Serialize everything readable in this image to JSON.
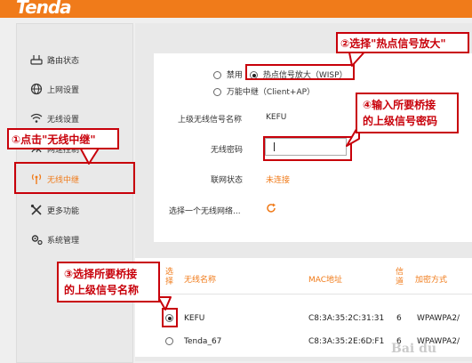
{
  "header": {
    "logo": "Tenda"
  },
  "sidebar": {
    "items": [
      {
        "label": "路由状态",
        "icon": "router-icon"
      },
      {
        "label": "上网设置",
        "icon": "globe-icon"
      },
      {
        "label": "无线设置",
        "icon": "wifi-icon"
      },
      {
        "label": "网速控制",
        "icon": "speed-icon"
      },
      {
        "label": "无线中继",
        "icon": "repeater-icon"
      },
      {
        "label": "更多功能",
        "icon": "tools-icon"
      },
      {
        "label": "系统管理",
        "icon": "gear-icon"
      }
    ]
  },
  "mode": {
    "options": [
      {
        "label": "禁用",
        "selected": false
      },
      {
        "label": "热点信号放大（WISP）",
        "selected": true
      },
      {
        "label": "万能中继（Client+AP）",
        "selected": false
      }
    ]
  },
  "form": {
    "ssid_label": "上级无线信号名称",
    "ssid_value": "KEFU",
    "password_label": "无线密码",
    "password_value": "",
    "status_label": "联网状态",
    "status_value": "未连接",
    "scan_label": "选择一个无线网络..."
  },
  "table": {
    "headers": [
      "选择",
      "无线名称",
      "MAC地址",
      "信道",
      "加密方式"
    ],
    "rows": [
      {
        "name": "KEFU",
        "mac": "C8:3A:35:2C:31:31",
        "channel": "6",
        "encryption": "WPAWPA2/",
        "selected": true
      },
      {
        "name": "Tenda_67",
        "mac": "C8:3A:35:2E:6D:F1",
        "channel": "6",
        "encryption": "WPAWPA2/",
        "selected": false
      }
    ]
  },
  "callouts": {
    "c1": "①点击\"无线中继\"",
    "c2": "②选择\"热点信号放大\"",
    "c3_line1": "③选择所要桥接",
    "c3_line2": "的上级信号名称",
    "c4_line1": "④输入所要桥接",
    "c4_line2": "的上级信号密码"
  },
  "watermark": "Bai du",
  "colors": {
    "accent": "#f07b1a",
    "annotation": "#c8000a"
  }
}
